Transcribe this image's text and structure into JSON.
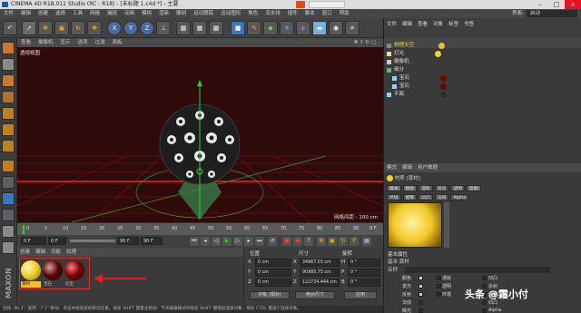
{
  "window": {
    "title": "CINEMA 4D R18.011 Studio (RC - R18) - [未标题 1.c4d *] - 主要",
    "layout_label": "界面:",
    "layout_value": "启动"
  },
  "menu": [
    "文件",
    "编辑",
    "创建",
    "选择",
    "工具",
    "网格",
    "捕捉",
    "动画",
    "模拟",
    "渲染",
    "雕刻",
    "运动跟踪",
    "运动图形",
    "角色",
    "流水线",
    "插件",
    "脚本",
    "窗口",
    "帮助"
  ],
  "toolbar": {
    "axis_x": "X",
    "axis_y": "Y",
    "axis_z": "Z"
  },
  "viewport": {
    "menu": [
      "查看",
      "摄像机",
      "显示",
      "选项",
      "过滤",
      "面板"
    ],
    "label": "透视视图",
    "grid_info": "网格间距 : 100 cm",
    "bg_color": "#2e0a0a"
  },
  "timeline": {
    "ticks": [
      "0",
      "5",
      "10",
      "15",
      "20",
      "25",
      "30",
      "35",
      "40",
      "45",
      "50",
      "55",
      "60",
      "65",
      "70",
      "75",
      "80",
      "85",
      "90"
    ],
    "end_frame_label": "0 F",
    "start_field": "0 F",
    "current_field": "0 F",
    "end_field": "90 F",
    "max_field": "90 F"
  },
  "material_manager": {
    "menu": [
      "创建",
      "编辑",
      "功能",
      "纹理"
    ],
    "materials": [
      {
        "name": "黄材",
        "color": "#f2d52a"
      },
      {
        "name": "宝石",
        "color": "#5a0a0a"
      },
      {
        "name": "红宝",
        "color": "#7a0000"
      }
    ]
  },
  "coordinates": {
    "headers": {
      "position": "位置",
      "size": "尺寸",
      "rotation": "旋转"
    },
    "rows": [
      {
        "axis": "X",
        "pos": "0 cm",
        "size_label": "X",
        "size": "34967.03 cm",
        "rot_label": "H",
        "rot": "0 °"
      },
      {
        "axis": "Y",
        "pos": "0 cm",
        "size_label": "Y",
        "size": "90985.75 cm",
        "rot_label": "P",
        "rot": "0 °"
      },
      {
        "axis": "Z",
        "pos": "0 cm",
        "size_label": "Z",
        "size": "122734.444 cm",
        "rot_label": "B",
        "rot": "0 °"
      }
    ],
    "mode_object": "对象 (相对)",
    "mode_size": "绝对尺寸",
    "apply": "应用"
  },
  "object_manager": {
    "tabs": [
      "文件",
      "编辑",
      "查看",
      "对象",
      "标签",
      "书签"
    ],
    "objects": [
      {
        "name": "物理天空",
        "indent": 0,
        "color": "#e6c12a"
      },
      {
        "name": "灯光",
        "indent": 0,
        "color": "#f0e08a"
      },
      {
        "name": "摄像机",
        "indent": 0,
        "color": "#cccccc"
      },
      {
        "name": "细分",
        "indent": 0,
        "color": "#5cc05c"
      },
      {
        "name": "宝石",
        "indent": 1,
        "color": "#9acfe9"
      },
      {
        "name": "宝石",
        "indent": 1,
        "color": "#9acfe9"
      },
      {
        "name": "平面",
        "indent": 0,
        "color": "#9acfe9"
      }
    ]
  },
  "attributes": {
    "tabs": [
      "模式",
      "编辑",
      "用户数据"
    ],
    "material_name": "材质 [黄材]",
    "chips": [
      "基本",
      "颜色",
      "漫射",
      "发光",
      "透明",
      "反射",
      "环境",
      "烟雾",
      "凹凸",
      "法线",
      "Alpha"
    ],
    "section": "基本属性",
    "basic_label": "基本",
    "basic_value": "黄材",
    "name_label": "名称",
    "checks_left": [
      {
        "label": "颜色",
        "on": true
      },
      {
        "label": "漫射",
        "on": false
      },
      {
        "label": "发光",
        "on": true
      },
      {
        "label": "透明",
        "on": false
      },
      {
        "label": "反射",
        "on": true
      },
      {
        "label": "环境",
        "on": false
      },
      {
        "label": "法线",
        "on": false
      },
      {
        "label": "辉光",
        "on": false
      }
    ],
    "checks_right": [
      {
        "label": "凹凸",
        "on": false
      },
      {
        "label": "反射",
        "on": false
      },
      {
        "label": "烟雾",
        "on": false
      },
      {
        "label": "凹凸",
        "on": false
      },
      {
        "label": "置换",
        "on": false
      },
      {
        "label": "Alpha",
        "on": false
      },
      {
        "label": "辉光",
        "on": false
      },
      {
        "label": "置换",
        "on": false
      }
    ]
  },
  "status": "位移: 90.3°, 旋转: -7.1° 移动：点击并拖动鼠标移动元素。按住 SHIFT 键量化移动；节点编辑模式时按住 SHIFT 键增加选择对象；按住 CTRL 键减少选择对象。",
  "watermark": "头条 @霜小付"
}
